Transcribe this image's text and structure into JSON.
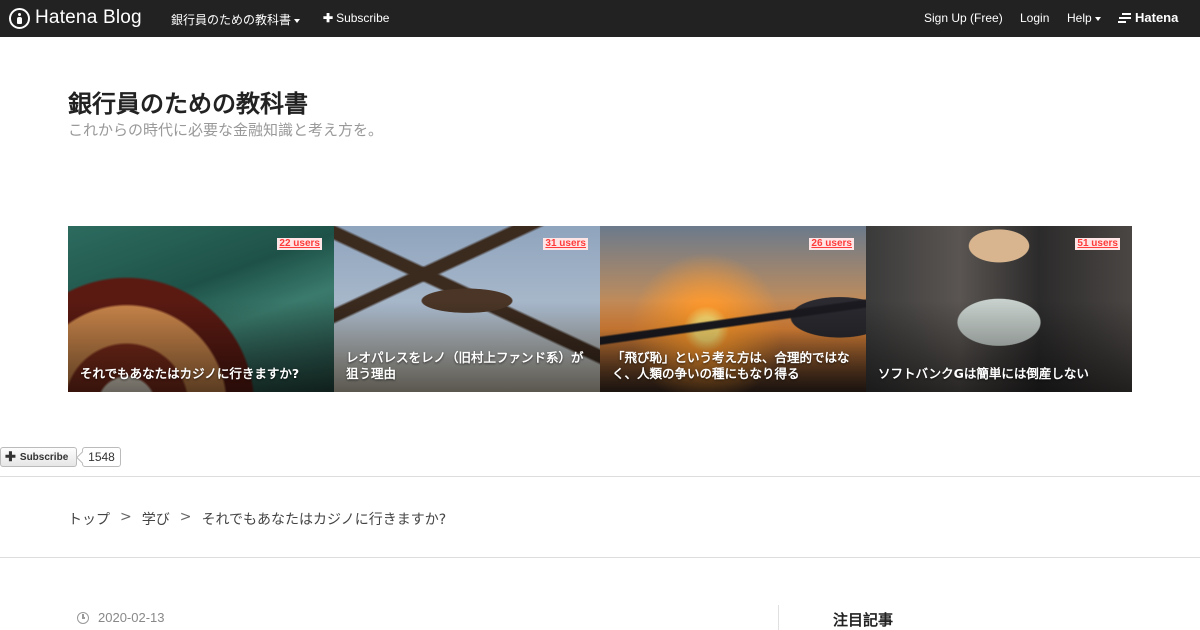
{
  "topbar": {
    "logo_text": "Hatena Blog",
    "blog_menu": "銀行員のための教科書",
    "subscribe": "Subscribe",
    "signup": "Sign Up (Free)",
    "login": "Login",
    "help": "Help",
    "brand": "Hatena"
  },
  "blog": {
    "title": "銀行員のための教科書",
    "description": "これからの時代に必要な金融知識と考え方を。"
  },
  "featured": [
    {
      "title": "それでもあなたはカジノに行きますか?",
      "users": "22 users",
      "theme": "casino"
    },
    {
      "title": "レオパレスをレノ（旧村上ファンド系）が狙う理由",
      "users": "31 users",
      "theme": "vulture"
    },
    {
      "title": "「飛び恥」という考え方は、合理的ではなく、人類の争いの種にもなり得る",
      "users": "26 users",
      "theme": "airplane-sunset"
    },
    {
      "title": "ソフトバンクGは簡単には倒産しない",
      "users": "51 users",
      "theme": "money"
    }
  ],
  "subscribe_widget": {
    "label": "Subscribe",
    "count": "1548"
  },
  "breadcrumb": {
    "items": [
      "トップ",
      "学び",
      "それでもあなたはカジノに行きますか?"
    ],
    "separator": ">"
  },
  "entry": {
    "date": "2020-02-13"
  },
  "sidebar": {
    "heading": "注目記事"
  },
  "colors": {
    "topbar": "#222222",
    "users_badge": "#ff3b3b",
    "text": "#333333",
    "muted": "#999999"
  },
  "icons": [
    "hatena-blog-logo-icon",
    "caret-down-icon",
    "plus-icon",
    "hatena-brand-icon",
    "clock-icon"
  ]
}
